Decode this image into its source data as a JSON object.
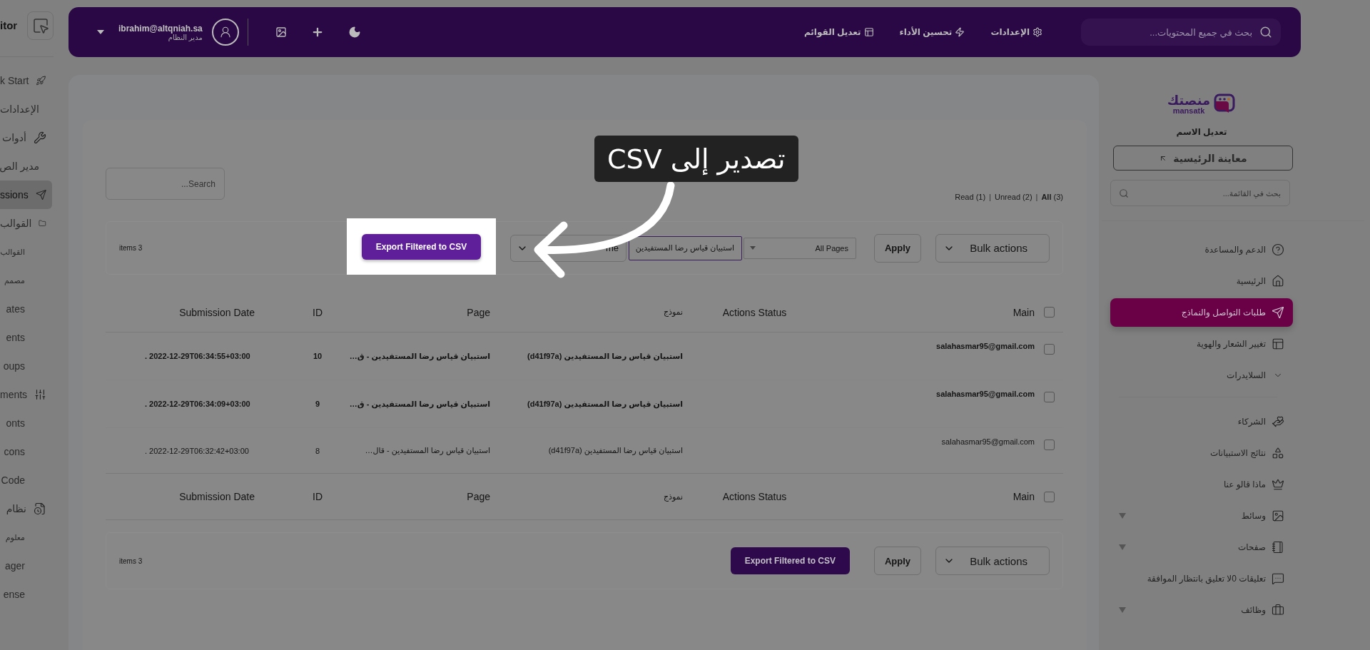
{
  "left_sidebar": {
    "title": "itor",
    "items": [
      {
        "kind": "item",
        "label": "k Start",
        "selected": false
      },
      {
        "kind": "item",
        "label": "الإعدادات",
        "selected": false
      },
      {
        "kind": "item",
        "label": "أدوات",
        "selected": false
      },
      {
        "kind": "item",
        "label": "مدير الص",
        "selected": false
      },
      {
        "kind": "item",
        "label": "ssions",
        "selected": true
      },
      {
        "kind": "item",
        "label": "القوالب",
        "selected": false
      },
      {
        "kind": "sub",
        "label": "القوالب",
        "selected": false
      },
      {
        "kind": "sub",
        "label": "مصمم",
        "selected": false
      },
      {
        "kind": "link",
        "label": "ates",
        "selected": false
      },
      {
        "kind": "link",
        "label": "ents",
        "selected": false
      },
      {
        "kind": "link",
        "label": "oups",
        "selected": false
      },
      {
        "kind": "item",
        "label": "ments",
        "selected": false
      },
      {
        "kind": "link",
        "label": "onts",
        "selected": false
      },
      {
        "kind": "link",
        "label": "cons",
        "selected": false
      },
      {
        "kind": "link",
        "label": "Code",
        "selected": false
      },
      {
        "kind": "item",
        "label": "نظام",
        "selected": false
      },
      {
        "kind": "sub",
        "label": "معلوم",
        "selected": false
      },
      {
        "kind": "link",
        "label": "ager",
        "selected": false
      },
      {
        "kind": "link",
        "label": "ense",
        "selected": false
      }
    ]
  },
  "top_bar": {
    "user": {
      "email": "ibrahim@altqniah.sa",
      "role": "مدير النظام"
    },
    "nav": [
      {
        "label": "الإعدادات"
      },
      {
        "label": "تحسين الأداء"
      },
      {
        "label": "تعديل القوائم"
      }
    ],
    "search": {
      "placeholder": "بحث في جميع المحتويات..."
    }
  },
  "right_sidebar": {
    "logo": {
      "arabic": "منصتك",
      "latin": "mansatk"
    },
    "site_name": "تعديل الاسم",
    "preview_button": "معاينة الرئيسية",
    "search": {
      "placeholder": "بحث في القائمة..."
    },
    "menu_groups": [
      [
        {
          "kind": "link",
          "label": "الدعم والمساعدة",
          "selected": false,
          "submenu": false
        },
        {
          "kind": "link",
          "label": "الرئيسية",
          "selected": false,
          "submenu": false
        },
        {
          "kind": "link",
          "label": "طلبات التواصل والنماذج",
          "selected": true,
          "submenu": false
        },
        {
          "kind": "link",
          "label": "تغيير الشعار والهوية",
          "selected": false,
          "submenu": false
        },
        {
          "kind": "toggle",
          "label": "السلايدرات",
          "selected": false,
          "submenu": false
        }
      ],
      [
        {
          "kind": "link",
          "label": "الشركاء",
          "selected": false,
          "submenu": false
        },
        {
          "kind": "link",
          "label": "نتائج الاستبيانات",
          "selected": false,
          "submenu": false
        },
        {
          "kind": "link",
          "label": "ماذا قالو عنا",
          "selected": false,
          "submenu": false
        },
        {
          "kind": "link",
          "label": "وسائط",
          "selected": false,
          "submenu": true
        },
        {
          "kind": "link",
          "label": "صفحات",
          "selected": false,
          "submenu": true
        },
        {
          "kind": "link",
          "label": "تعليقات 0لا تعليق بانتظار الموافقة",
          "selected": false,
          "submenu": false
        },
        {
          "kind": "link",
          "label": "وظائف",
          "selected": false,
          "submenu": true
        }
      ]
    ]
  },
  "content": {
    "search": {
      "placeholder": "Search..."
    },
    "filters": [
      {
        "label": "All",
        "count": "(3)",
        "selected": true
      },
      {
        "label": "Unread",
        "count": "(2)",
        "selected": false
      },
      {
        "label": "Read",
        "count": "(1)",
        "selected": false
      }
    ],
    "filter_separator": "|",
    "top_toolbar": {
      "bulk_actions": "Bulk actions",
      "apply": "Apply",
      "pages_filter": "All Pages",
      "form_filter": "استبيان قياس رضا المستفيدين",
      "date_filter": "me",
      "export": "Export Filtered to CSV",
      "count": "items 3"
    },
    "table": {
      "columns": [
        "Main",
        "Actions Status",
        "نموذج",
        "Page",
        "ID",
        "Submission Date"
      ],
      "select_all_checked": false,
      "rows": [
        {
          "checked": false,
          "unread": true,
          "email": "salahasmar95@gmail.com",
          "status": "",
          "form": "استبيان قياس رضا المستفيدين (d41f97a)",
          "page": "استبيان قياس رضا المستفيدين - ق…",
          "id": "10",
          "date": ". 2022-12-29T06:34:55+03:00"
        },
        {
          "checked": false,
          "unread": true,
          "email": "salahasmar95@gmail.com",
          "status": "",
          "form": "استبيان قياس رضا المستفيدين (d41f97a)",
          "page": "استبيان قياس رضا المستفيدين - ق…",
          "id": "9",
          "date": ". 2022-12-29T06:34:09+03:00"
        },
        {
          "checked": false,
          "unread": false,
          "email": "salahasmar95@gmail.com",
          "status": "",
          "form": "استبيان قياس رضا المستفيدين (d41f97a)",
          "page": "استبيان قياس رضا المستفيدين - قال…",
          "id": "8",
          "date": ". 2022-12-29T06:32:42+03:00"
        }
      ],
      "footer_columns": [
        "Main",
        "Actions Status",
        "نموذج",
        "Page",
        "ID",
        "Submission Date"
      ],
      "footer_select_all_checked": false
    },
    "bottom_toolbar": {
      "bulk_actions": "Bulk actions",
      "apply": "Apply",
      "export": "Export Filtered to CSV",
      "count": "items 3"
    }
  },
  "annotation": {
    "callout": "تصدير إلى CSV"
  }
}
